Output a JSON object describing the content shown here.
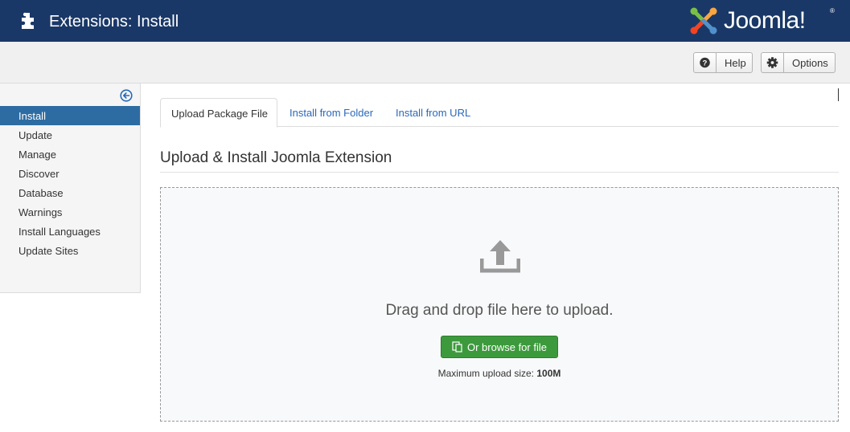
{
  "header": {
    "title": "Extensions: Install",
    "logo_text": "Joomla!",
    "logo_reg": "®",
    "color": "#1a3867"
  },
  "toolbar": {
    "help_label": "Help",
    "help_icon": "question-circle-icon",
    "options_label": "Options",
    "options_icon": "gear-icon"
  },
  "sidebar": {
    "collapse_icon": "arrow-left-circle-icon",
    "items": [
      {
        "label": "Install",
        "active": true
      },
      {
        "label": "Update",
        "active": false
      },
      {
        "label": "Manage",
        "active": false
      },
      {
        "label": "Discover",
        "active": false
      },
      {
        "label": "Database",
        "active": false
      },
      {
        "label": "Warnings",
        "active": false
      },
      {
        "label": "Install Languages",
        "active": false
      },
      {
        "label": "Update Sites",
        "active": false
      }
    ],
    "active_color": "#2d6ca2"
  },
  "main": {
    "tabs": [
      {
        "label": "Upload Package File",
        "active": true
      },
      {
        "label": "Install from Folder",
        "active": false
      },
      {
        "label": "Install from URL",
        "active": false
      }
    ],
    "section_title": "Upload & Install Joomla Extension",
    "dropzone": {
      "icon": "upload-icon",
      "drag_text": "Drag and drop file here to upload.",
      "browse_label": "Or browse for file",
      "browse_icon": "files-icon",
      "browse_color": "#3c9a3c",
      "max_label": "Maximum upload size:",
      "max_value": "100M"
    }
  }
}
